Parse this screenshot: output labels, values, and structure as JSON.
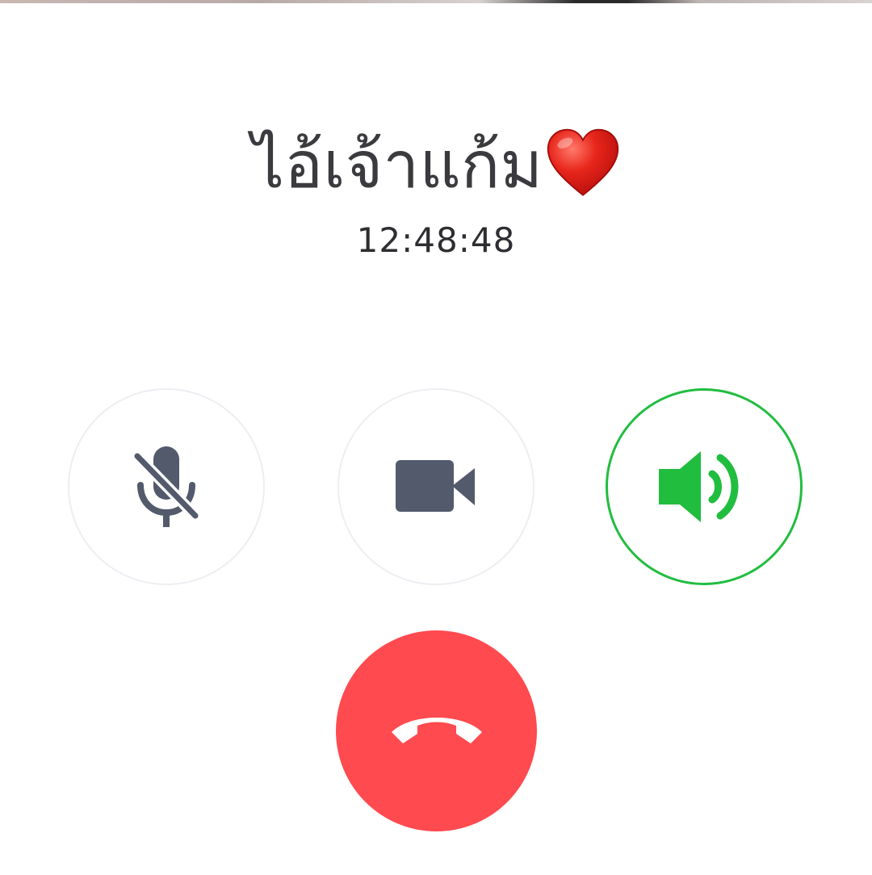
{
  "call": {
    "caller_name": "ไอ้เจ้าแก้ม",
    "caller_emoji": "heart-emoji",
    "timer": "12:48:48"
  },
  "controls": [
    {
      "id": "mute",
      "icon": "microphone-off-icon",
      "state": "off"
    },
    {
      "id": "video",
      "icon": "video-camera-icon",
      "state": "off"
    },
    {
      "id": "speaker",
      "icon": "speaker-icon",
      "state": "on"
    }
  ],
  "end_call": {
    "icon": "phone-hangup-icon"
  },
  "colors": {
    "text": "#3b3b3f",
    "icon_gray": "#535a6c",
    "active_green": "#21bd3f",
    "end_red": "#ff4a4f",
    "button_border": "#eceef2"
  }
}
